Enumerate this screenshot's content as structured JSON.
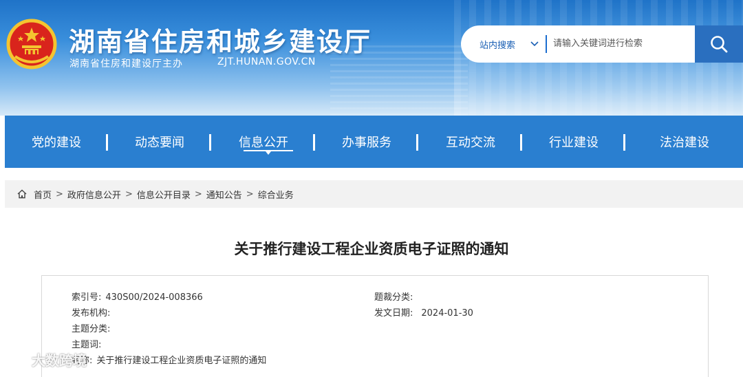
{
  "header": {
    "title": "湖南省住房和城乡建设厅",
    "subtitle": "湖南省住房和建设厅主办",
    "url": "ZJT.HUNAN.GOV.CN"
  },
  "search": {
    "scope": "站内搜索",
    "placeholder": "请输入关键词进行检索"
  },
  "nav": {
    "items": [
      {
        "label": "党的建设"
      },
      {
        "label": "动态要闻"
      },
      {
        "label": "信息公开"
      },
      {
        "label": "办事服务"
      },
      {
        "label": "互动交流"
      },
      {
        "label": "行业建设"
      },
      {
        "label": "法治建设"
      }
    ],
    "active": "信息公开"
  },
  "breadcrumb": {
    "items": [
      "首页",
      "政府信息公开",
      "信息公开目录",
      "通知公告",
      "综合业务"
    ],
    "separator": ">"
  },
  "article": {
    "title": "关于推行建设工程企业资质电子证照的通知",
    "meta": {
      "index_label": "索引号:",
      "index_value": "430S00/2024-008366",
      "genre_label": "题裁分类:",
      "genre_value": "",
      "publisher_label": "发布机构:",
      "publisher_value": "",
      "date_label": "发文日期:",
      "date_value": "2024-01-30",
      "topic_label": "主题分类:",
      "topic_value": "",
      "keywords_label": "主题词:",
      "keywords_value": "",
      "name_label": "名称:",
      "name_value": "关于推行建设工程企业资质电子证照的通知"
    }
  },
  "watermark": "大数跨境",
  "colors": {
    "nav_bg": "#2a7fd0",
    "search_btn": "#2a6fbf",
    "crumb_bg": "#f2f2f2"
  },
  "icons": [
    "national-emblem-icon",
    "chevron-down-icon",
    "search-icon",
    "home-icon",
    "weibo-icon"
  ]
}
